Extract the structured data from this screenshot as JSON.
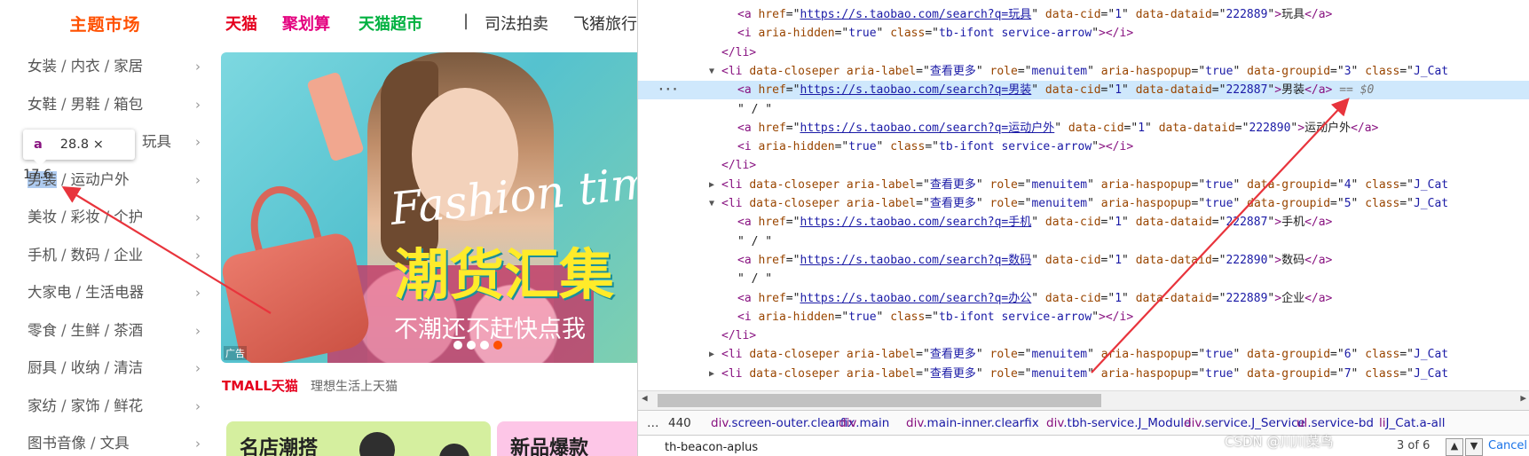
{
  "page": {
    "category_title": "主题市场",
    "categories": [
      {
        "items": [
          "女装",
          "内衣",
          "家居"
        ]
      },
      {
        "items": [
          "女鞋",
          "男鞋",
          "箱包"
        ]
      },
      {
        "items": [
          "",
          "",
          "玩具"
        ]
      },
      {
        "items": [
          "男装",
          "运动户外"
        ]
      },
      {
        "items": [
          "美妆",
          "彩妆",
          "个护"
        ]
      },
      {
        "items": [
          "手机",
          "数码",
          "企业"
        ]
      },
      {
        "items": [
          "大家电",
          "生活电器"
        ]
      },
      {
        "items": [
          "零食",
          "生鲜",
          "茶酒"
        ]
      },
      {
        "items": [
          "厨具",
          "收纳",
          "清洁"
        ]
      },
      {
        "items": [
          "家纺",
          "家饰",
          "鲜花"
        ]
      },
      {
        "items": [
          "图书音像",
          "文具"
        ]
      }
    ],
    "category_separator": "/",
    "category_arrow": "›",
    "tooltip": {
      "tag": "a",
      "size": "28.8 × 17.6"
    },
    "nav": {
      "tmall": "天猫",
      "juhuasuan": "聚划算",
      "tmall_super": "天猫超市",
      "divider": "|",
      "auction": "司法拍卖",
      "fliggy": "飞猪旅行"
    },
    "banner": {
      "fashion_text": "Fashion time!",
      "slogan": "潮货汇集",
      "subtext": "不潮还不赶快点我",
      "ad_label": "广告",
      "dots": 4,
      "active_dot": 3
    },
    "tmall_logo": "TMALL天猫",
    "tmall_slogan": "理想生活上天猫",
    "cards": {
      "green_title": "名店潮搭",
      "pink_title": "新品爆款"
    },
    "colors": {
      "brand_orange": "#ff5000",
      "tmall_red": "#e5001e",
      "juhuasuan_red": "#e4007f",
      "super_green": "#00b140",
      "arrow_red": "#e8343c"
    }
  },
  "devtools": {
    "lines": [
      {
        "indent": 0,
        "parts": [
          [
            "t",
            "<a "
          ],
          [
            "an",
            "href"
          ],
          [
            "pl",
            "=\""
          ],
          [
            "lnk",
            "https://s.taobao.com/search?q=玩具"
          ],
          [
            "pl",
            "\" "
          ],
          [
            "an",
            "data-cid"
          ],
          [
            "pl",
            "=\""
          ],
          [
            "av",
            "1"
          ],
          [
            "pl",
            "\" "
          ],
          [
            "an",
            "data-dataid"
          ],
          [
            "pl",
            "=\""
          ],
          [
            "av",
            "222889"
          ],
          [
            "pl",
            "\""
          ],
          [
            "t",
            ">"
          ],
          [
            "pl",
            "玩具"
          ],
          [
            "t",
            "</a>"
          ]
        ]
      },
      {
        "indent": 0,
        "parts": [
          [
            "t",
            "<i "
          ],
          [
            "an",
            "aria-hidden"
          ],
          [
            "pl",
            "=\""
          ],
          [
            "av",
            "true"
          ],
          [
            "pl",
            "\" "
          ],
          [
            "an",
            "class"
          ],
          [
            "pl",
            "=\""
          ],
          [
            "av",
            "tb-ifont service-arrow"
          ],
          [
            "pl",
            "\""
          ],
          [
            "t",
            ">"
          ],
          [
            "pl",
            ""
          ],
          [
            "t",
            "</i>"
          ]
        ]
      },
      {
        "indent": -1,
        "parts": [
          [
            "t",
            "</li>"
          ]
        ]
      },
      {
        "indent": -1,
        "tri": "▼",
        "parts": [
          [
            "t",
            "<li "
          ],
          [
            "an",
            "data-closeper"
          ],
          [
            "pl",
            " "
          ],
          [
            "an",
            "aria-label"
          ],
          [
            "pl",
            "=\""
          ],
          [
            "av",
            "查看更多"
          ],
          [
            "pl",
            "\" "
          ],
          [
            "an",
            "role"
          ],
          [
            "pl",
            "=\""
          ],
          [
            "av",
            "menuitem"
          ],
          [
            "pl",
            "\" "
          ],
          [
            "an",
            "aria-haspopup"
          ],
          [
            "pl",
            "=\""
          ],
          [
            "av",
            "true"
          ],
          [
            "pl",
            "\" "
          ],
          [
            "an",
            "data-groupid"
          ],
          [
            "pl",
            "=\""
          ],
          [
            "av",
            "3"
          ],
          [
            "pl",
            "\" "
          ],
          [
            "an",
            "class"
          ],
          [
            "pl",
            "=\""
          ],
          [
            "av",
            "J_Cat"
          ]
        ]
      },
      {
        "indent": 0,
        "selected": true,
        "parts": [
          [
            "t",
            "<a "
          ],
          [
            "an",
            "href"
          ],
          [
            "pl",
            "=\""
          ],
          [
            "lnk",
            "https://s.taobao.com/search?q=男装"
          ],
          [
            "pl",
            "\" "
          ],
          [
            "an",
            "data-cid"
          ],
          [
            "pl",
            "=\""
          ],
          [
            "av",
            "1"
          ],
          [
            "pl",
            "\" "
          ],
          [
            "an",
            "data-dataid"
          ],
          [
            "pl",
            "=\""
          ],
          [
            "av",
            "222887"
          ],
          [
            "pl",
            "\""
          ],
          [
            "t",
            ">"
          ],
          [
            "pl",
            "男装"
          ],
          [
            "t",
            "</a>"
          ],
          [
            "dim",
            " == $0"
          ]
        ]
      },
      {
        "indent": 0,
        "parts": [
          [
            "pl",
            "\" / \""
          ]
        ]
      },
      {
        "indent": 0,
        "parts": [
          [
            "t",
            "<a "
          ],
          [
            "an",
            "href"
          ],
          [
            "pl",
            "=\""
          ],
          [
            "lnk",
            "https://s.taobao.com/search?q=运动户外"
          ],
          [
            "pl",
            "\" "
          ],
          [
            "an",
            "data-cid"
          ],
          [
            "pl",
            "=\""
          ],
          [
            "av",
            "1"
          ],
          [
            "pl",
            "\" "
          ],
          [
            "an",
            "data-dataid"
          ],
          [
            "pl",
            "=\""
          ],
          [
            "av",
            "222890"
          ],
          [
            "pl",
            "\""
          ],
          [
            "t",
            ">"
          ],
          [
            "pl",
            "运动户外"
          ],
          [
            "t",
            "</a>"
          ]
        ]
      },
      {
        "indent": 0,
        "parts": [
          [
            "t",
            "<i "
          ],
          [
            "an",
            "aria-hidden"
          ],
          [
            "pl",
            "=\""
          ],
          [
            "av",
            "true"
          ],
          [
            "pl",
            "\" "
          ],
          [
            "an",
            "class"
          ],
          [
            "pl",
            "=\""
          ],
          [
            "av",
            "tb-ifont service-arrow"
          ],
          [
            "pl",
            "\""
          ],
          [
            "t",
            ">"
          ],
          [
            "pl",
            ""
          ],
          [
            "t",
            "</i>"
          ]
        ]
      },
      {
        "indent": -1,
        "parts": [
          [
            "t",
            "</li>"
          ]
        ]
      },
      {
        "indent": -1,
        "tri": "▶",
        "parts": [
          [
            "t",
            "<li "
          ],
          [
            "an",
            "data-closeper"
          ],
          [
            "pl",
            " "
          ],
          [
            "an",
            "aria-label"
          ],
          [
            "pl",
            "=\""
          ],
          [
            "av",
            "查看更多"
          ],
          [
            "pl",
            "\" "
          ],
          [
            "an",
            "role"
          ],
          [
            "pl",
            "=\""
          ],
          [
            "av",
            "menuitem"
          ],
          [
            "pl",
            "\" "
          ],
          [
            "an",
            "aria-haspopup"
          ],
          [
            "pl",
            "=\""
          ],
          [
            "av",
            "true"
          ],
          [
            "pl",
            "\" "
          ],
          [
            "an",
            "data-groupid"
          ],
          [
            "pl",
            "=\""
          ],
          [
            "av",
            "4"
          ],
          [
            "pl",
            "\" "
          ],
          [
            "an",
            "class"
          ],
          [
            "pl",
            "=\""
          ],
          [
            "av",
            "J_Cat"
          ]
        ]
      },
      {
        "indent": -1,
        "tri": "▼",
        "parts": [
          [
            "t",
            "<li "
          ],
          [
            "an",
            "data-closeper"
          ],
          [
            "pl",
            " "
          ],
          [
            "an",
            "aria-label"
          ],
          [
            "pl",
            "=\""
          ],
          [
            "av",
            "查看更多"
          ],
          [
            "pl",
            "\" "
          ],
          [
            "an",
            "role"
          ],
          [
            "pl",
            "=\""
          ],
          [
            "av",
            "menuitem"
          ],
          [
            "pl",
            "\" "
          ],
          [
            "an",
            "aria-haspopup"
          ],
          [
            "pl",
            "=\""
          ],
          [
            "av",
            "true"
          ],
          [
            "pl",
            "\" "
          ],
          [
            "an",
            "data-groupid"
          ],
          [
            "pl",
            "=\""
          ],
          [
            "av",
            "5"
          ],
          [
            "pl",
            "\" "
          ],
          [
            "an",
            "class"
          ],
          [
            "pl",
            "=\""
          ],
          [
            "av",
            "J_Cat"
          ]
        ]
      },
      {
        "indent": 0,
        "parts": [
          [
            "t",
            "<a "
          ],
          [
            "an",
            "href"
          ],
          [
            "pl",
            "=\""
          ],
          [
            "lnk",
            "https://s.taobao.com/search?q=手机"
          ],
          [
            "pl",
            "\" "
          ],
          [
            "an",
            "data-cid"
          ],
          [
            "pl",
            "=\""
          ],
          [
            "av",
            "1"
          ],
          [
            "pl",
            "\" "
          ],
          [
            "an",
            "data-dataid"
          ],
          [
            "pl",
            "=\""
          ],
          [
            "av",
            "222887"
          ],
          [
            "pl",
            "\""
          ],
          [
            "t",
            ">"
          ],
          [
            "pl",
            "手机"
          ],
          [
            "t",
            "</a>"
          ]
        ]
      },
      {
        "indent": 0,
        "parts": [
          [
            "pl",
            "\" / \""
          ]
        ]
      },
      {
        "indent": 0,
        "parts": [
          [
            "t",
            "<a "
          ],
          [
            "an",
            "href"
          ],
          [
            "pl",
            "=\""
          ],
          [
            "lnk",
            "https://s.taobao.com/search?q=数码"
          ],
          [
            "pl",
            "\" "
          ],
          [
            "an",
            "data-cid"
          ],
          [
            "pl",
            "=\""
          ],
          [
            "av",
            "1"
          ],
          [
            "pl",
            "\" "
          ],
          [
            "an",
            "data-dataid"
          ],
          [
            "pl",
            "=\""
          ],
          [
            "av",
            "222890"
          ],
          [
            "pl",
            "\""
          ],
          [
            "t",
            ">"
          ],
          [
            "pl",
            "数码"
          ],
          [
            "t",
            "</a>"
          ]
        ]
      },
      {
        "indent": 0,
        "parts": [
          [
            "pl",
            "\" / \""
          ]
        ]
      },
      {
        "indent": 0,
        "parts": [
          [
            "t",
            "<a "
          ],
          [
            "an",
            "href"
          ],
          [
            "pl",
            "=\""
          ],
          [
            "lnk",
            "https://s.taobao.com/search?q=办公"
          ],
          [
            "pl",
            "\" "
          ],
          [
            "an",
            "data-cid"
          ],
          [
            "pl",
            "=\""
          ],
          [
            "av",
            "1"
          ],
          [
            "pl",
            "\" "
          ],
          [
            "an",
            "data-dataid"
          ],
          [
            "pl",
            "=\""
          ],
          [
            "av",
            "222889"
          ],
          [
            "pl",
            "\""
          ],
          [
            "t",
            ">"
          ],
          [
            "pl",
            "企业"
          ],
          [
            "t",
            "</a>"
          ]
        ]
      },
      {
        "indent": 0,
        "parts": [
          [
            "t",
            "<i "
          ],
          [
            "an",
            "aria-hidden"
          ],
          [
            "pl",
            "=\""
          ],
          [
            "av",
            "true"
          ],
          [
            "pl",
            "\" "
          ],
          [
            "an",
            "class"
          ],
          [
            "pl",
            "=\""
          ],
          [
            "av",
            "tb-ifont service-arrow"
          ],
          [
            "pl",
            "\""
          ],
          [
            "t",
            ">"
          ],
          [
            "pl",
            ""
          ],
          [
            "t",
            "</i>"
          ]
        ]
      },
      {
        "indent": -1,
        "parts": [
          [
            "t",
            "</li>"
          ]
        ]
      },
      {
        "indent": -1,
        "tri": "▶",
        "parts": [
          [
            "t",
            "<li "
          ],
          [
            "an",
            "data-closeper"
          ],
          [
            "pl",
            " "
          ],
          [
            "an",
            "aria-label"
          ],
          [
            "pl",
            "=\""
          ],
          [
            "av",
            "查看更多"
          ],
          [
            "pl",
            "\" "
          ],
          [
            "an",
            "role"
          ],
          [
            "pl",
            "=\""
          ],
          [
            "av",
            "menuitem"
          ],
          [
            "pl",
            "\" "
          ],
          [
            "an",
            "aria-haspopup"
          ],
          [
            "pl",
            "=\""
          ],
          [
            "av",
            "true"
          ],
          [
            "pl",
            "\" "
          ],
          [
            "an",
            "data-groupid"
          ],
          [
            "pl",
            "=\""
          ],
          [
            "av",
            "6"
          ],
          [
            "pl",
            "\" "
          ],
          [
            "an",
            "class"
          ],
          [
            "pl",
            "=\""
          ],
          [
            "av",
            "J_Cat"
          ]
        ]
      },
      {
        "indent": -1,
        "tri": "▶",
        "parts": [
          [
            "t",
            "<li "
          ],
          [
            "an",
            "data-closeper"
          ],
          [
            "pl",
            " "
          ],
          [
            "an",
            "aria-label"
          ],
          [
            "pl",
            "=\""
          ],
          [
            "av",
            "查看更多"
          ],
          [
            "pl",
            "\" "
          ],
          [
            "an",
            "role"
          ],
          [
            "pl",
            "=\""
          ],
          [
            "av",
            "menuitem"
          ],
          [
            "pl",
            "\" "
          ],
          [
            "an",
            "aria-haspopup"
          ],
          [
            "pl",
            "=\""
          ],
          [
            "av",
            "true"
          ],
          [
            "pl",
            "\" "
          ],
          [
            "an",
            "data-groupid"
          ],
          [
            "pl",
            "=\""
          ],
          [
            "av",
            "7"
          ],
          [
            "pl",
            "\" "
          ],
          [
            "an",
            "class"
          ],
          [
            "pl",
            "=\""
          ],
          [
            "av",
            "J_Cat"
          ]
        ]
      }
    ],
    "breadcrumbs": [
      {
        "text": "440"
      },
      {
        "tag": "div",
        "cls": ".screen-outer.clearfix"
      },
      {
        "tag": "div",
        "cls": ".main"
      },
      {
        "tag": "div",
        "cls": ".main-inner.clearfix"
      },
      {
        "tag": "div",
        "cls": ".tbh-service.J_Module"
      },
      {
        "tag": "div",
        "cls": ".service.J_Service"
      },
      {
        "tag": "ul",
        "cls": ".service-bd"
      },
      {
        "tag": "li",
        "cls": "J_Cat.a-all"
      }
    ],
    "search": {
      "value": "th-beacon-aplus",
      "count": "3 of 6",
      "cancel": "Cancel",
      "up": "▲",
      "down": "▼"
    },
    "watermark": "CSDN @川川菜鸟"
  }
}
